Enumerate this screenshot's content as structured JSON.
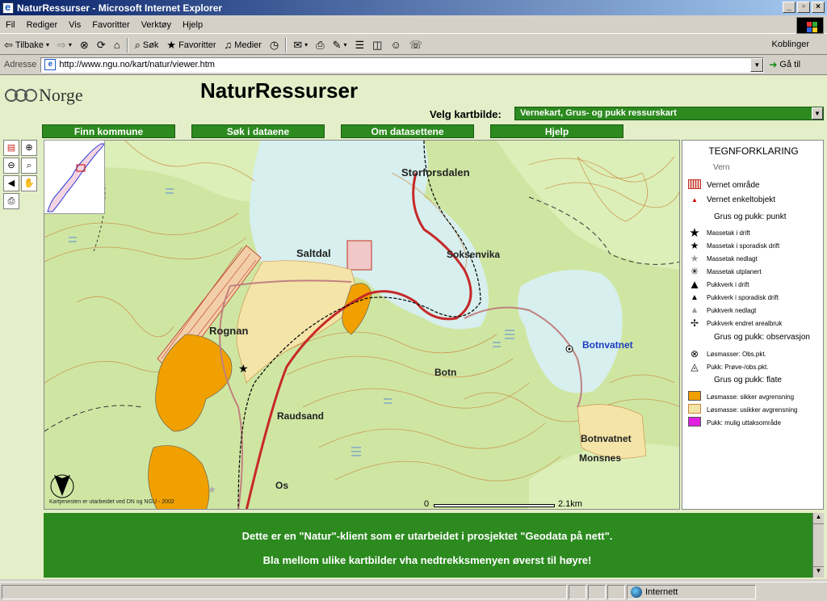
{
  "window": {
    "title": "NaturRessurser - Microsoft Internet Explorer"
  },
  "menu": [
    "Fil",
    "Rediger",
    "Vis",
    "Favoritter",
    "Verktøy",
    "Hjelp"
  ],
  "toolbar": {
    "back": "Tilbake",
    "search": "Søk",
    "favorites": "Favoritter",
    "media": "Medier",
    "links": "Koblinger"
  },
  "address": {
    "label": "Adresse",
    "url": "http://www.ngu.no/kart/natur/viewer.htm",
    "go": "Gå til"
  },
  "page": {
    "logo_text": "Norge",
    "title": "NaturRessurser",
    "select_label": "Velg kartbilde:",
    "select_value": "Vernekart, Grus- og pukk ressurskart",
    "nav": [
      "Finn kommune",
      "Søk i dataene",
      "Om datasettene",
      "Hjelp"
    ]
  },
  "map": {
    "places": [
      "Storforsdalen",
      "Saltdal",
      "Soksenvika",
      "Rognan",
      "Botnvatnet",
      "Botn",
      "Raudsand",
      "Botnvatnet",
      "Monsnes",
      "Os"
    ],
    "credit": "Kartjenesten er utarbeidet ved DN og NGU - 2002",
    "scale_start": "0",
    "scale_end": "2.1km"
  },
  "legend": {
    "title": "TEGNFORKLARING",
    "subtitle": "Vern",
    "items": [
      {
        "label": "Vernet område",
        "icon": "hatched-area-icon"
      },
      {
        "label": "Vernet enkeltobjekt",
        "icon": "red-triangle-icon"
      }
    ],
    "head_punkt": "Grus og pukk: punkt",
    "punkt": [
      "Massetak i drift",
      "Massetak i sporadisk drift",
      "Massetak nedlagt",
      "Massetak utplanert",
      "Pukkverk i drift",
      "Pukkverk i sporadisk drift",
      "Pukkverk nedlagt",
      "Pukkverk endret arealbruk"
    ],
    "head_obs": "Grus og pukk: observasjon",
    "obs": [
      "Løsmasser: Obs.pkt.",
      "Pukk: Prøve-/obs.pkt."
    ],
    "head_flate": "Grus og pukk: flate",
    "flate": [
      "Løsmasse: sikker avgrensning",
      "Løsmasse: usikker avgrensning",
      "Pukk: mulig uttaksområde"
    ],
    "colors": {
      "sikker": "#f0a000",
      "usikker": "#f4e4a8",
      "pukk": "#e020e0"
    }
  },
  "message": {
    "line1": "Dette er en \"Natur\"-klient som er utarbeidet i prosjektet \"Geodata på nett\".",
    "line2": "Bla mellom ulike kartbilder vha nedtrekksmenyen øverst til høyre!"
  },
  "status": {
    "zone": "Internett"
  }
}
